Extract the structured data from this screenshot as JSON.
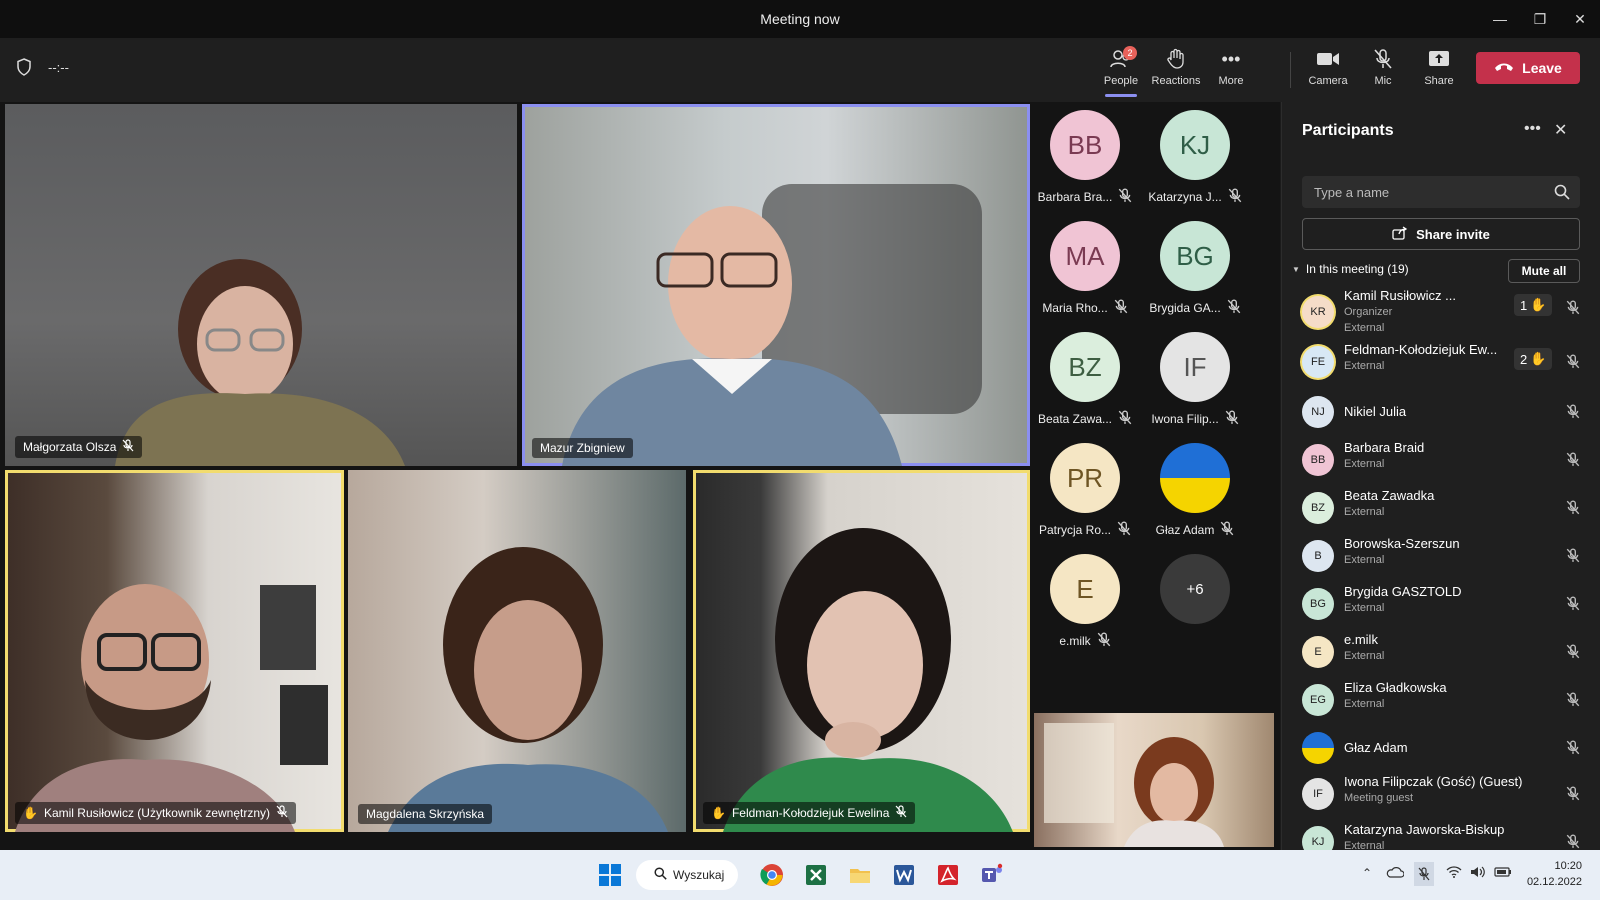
{
  "window": {
    "title": "Meeting now",
    "timer": "--:--"
  },
  "toolbar": {
    "people_label": "People",
    "people_badge": "2",
    "reactions_label": "Reactions",
    "more_label": "More",
    "camera_label": "Camera",
    "mic_label": "Mic",
    "share_label": "Share",
    "leave_label": "Leave"
  },
  "videos": [
    {
      "name": "Małgorzata Olsza"
    },
    {
      "name": "Mazur Zbigniew"
    },
    {
      "name": "Kamil Rusiłowicz (Użytkownik zewnętrzny)"
    },
    {
      "name": "Magdalena Skrzyńska"
    },
    {
      "name": "Feldman-Kołodziejuk Ewelina"
    }
  ],
  "avatars": [
    {
      "initials": "BB",
      "name": "Barbara Bra...",
      "bg": "#f0c4d4",
      "fg": "#7a3a52"
    },
    {
      "initials": "KJ",
      "name": "Katarzyna J...",
      "bg": "#c8e6d6",
      "fg": "#2f5e47"
    },
    {
      "initials": "MA",
      "name": "Maria Rho...",
      "bg": "#f0c4d4",
      "fg": "#7a3a52"
    },
    {
      "initials": "BG",
      "name": "Brygida GA...",
      "bg": "#c8e6d6",
      "fg": "#2f5e47"
    },
    {
      "initials": "BZ",
      "name": "Beata Zawa...",
      "bg": "#dbeedd",
      "fg": "#3e5e42"
    },
    {
      "initials": "IF",
      "name": "Iwona Filip...",
      "bg": "#e4e4e4",
      "fg": "#555555"
    },
    {
      "initials": "PR",
      "name": "Patrycja Ro...",
      "bg": "#f5e6c4",
      "fg": "#6e5524"
    },
    {
      "initials": "",
      "name": "Głaz Adam",
      "bg": "flag",
      "fg": "#000000"
    },
    {
      "initials": "E",
      "name": "e.milk",
      "bg": "#f5e6c4",
      "fg": "#6e5524"
    },
    {
      "initials": "+6",
      "name": "",
      "bg": "#3a3a3a",
      "fg": "#ffffff"
    }
  ],
  "panel": {
    "title": "Participants",
    "search_placeholder": "Type a name",
    "share_invite": "Share invite",
    "section_label": "In this meeting (19)",
    "mute_all": "Mute all",
    "participants": [
      {
        "initials": "KR",
        "name": "Kamil Rusiłowicz ...",
        "sub": "Organizer",
        "sub2": "External",
        "hand": "1",
        "bg": "#f5dcc8"
      },
      {
        "initials": "FE",
        "name": "Feldman-Kołodziejuk Ew...",
        "sub": "External",
        "hand": "2",
        "bg": "#d8e8f5"
      },
      {
        "initials": "NJ",
        "name": "Nikiel Julia",
        "sub": "",
        "bg": "#dde6f0"
      },
      {
        "initials": "BB",
        "name": "Barbara Braid",
        "sub": "External",
        "bg": "#f0c4d4"
      },
      {
        "initials": "BZ",
        "name": "Beata Zawadka",
        "sub": "External",
        "bg": "#dbeedd"
      },
      {
        "initials": "B",
        "name": "Borowska-Szerszun",
        "sub": "External",
        "bg": "#dde6f0"
      },
      {
        "initials": "BG",
        "name": "Brygida GASZTOLD",
        "sub": "External",
        "bg": "#c8e6d6"
      },
      {
        "initials": "E",
        "name": "e.milk",
        "sub": "External",
        "bg": "#f5e6c4"
      },
      {
        "initials": "EG",
        "name": "Eliza Gładkowska",
        "sub": "External",
        "bg": "#c8e6d6"
      },
      {
        "initials": "",
        "name": "Głaz Adam",
        "sub": "",
        "bg": "flag"
      },
      {
        "initials": "IF",
        "name": "Iwona Filipczak (Gość) (Guest)",
        "sub": "Meeting guest",
        "bg": "#e4e4e4"
      },
      {
        "initials": "KJ",
        "name": "Katarzyna Jaworska-Biskup",
        "sub": "External",
        "bg": "#c8e6d6"
      }
    ]
  },
  "taskbar": {
    "search_label": "Wyszukaj",
    "time": "10:20",
    "date": "02.12.2022"
  },
  "colors": {
    "leave": "#c4314b",
    "accent": "#8b8ff0",
    "raised_hand": "#f2dc6e"
  }
}
